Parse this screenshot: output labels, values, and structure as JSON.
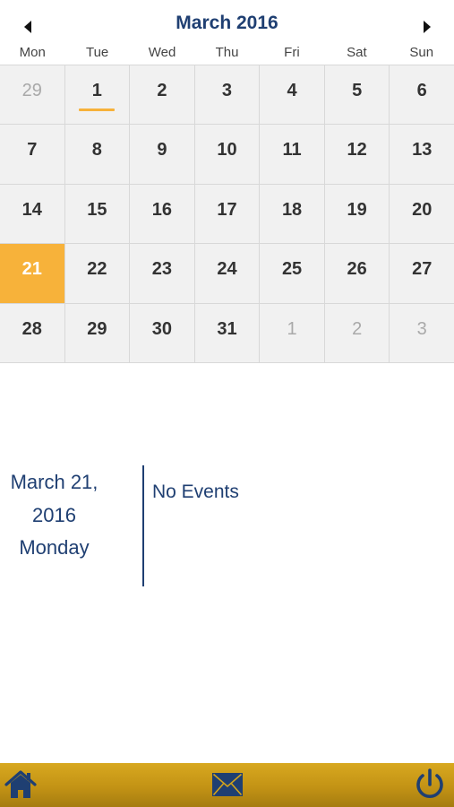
{
  "calendar": {
    "title": "March 2016",
    "weekdays": [
      "Mon",
      "Tue",
      "Wed",
      "Thu",
      "Fri",
      "Sat",
      "Sun"
    ],
    "weeks": [
      [
        "29",
        "1",
        "2",
        "3",
        "4",
        "5",
        "6"
      ],
      [
        "7",
        "8",
        "9",
        "10",
        "11",
        "12",
        "13"
      ],
      [
        "14",
        "15",
        "16",
        "17",
        "18",
        "19",
        "20"
      ],
      [
        "21",
        "22",
        "23",
        "24",
        "25",
        "26",
        "27"
      ],
      [
        "28",
        "29",
        "30",
        "31",
        "1",
        "2",
        "3"
      ]
    ],
    "selected_label": "21",
    "today_label": "1",
    "colors": {
      "accent": "#f7b23a",
      "title": "#1f3f72"
    }
  },
  "detail": {
    "date_line1": "March 21,",
    "date_line2": "2016",
    "weekday": "Monday",
    "no_events": "No Events"
  },
  "bottom_bar": {
    "icons": [
      "home-icon",
      "mail-icon",
      "power-icon"
    ]
  }
}
